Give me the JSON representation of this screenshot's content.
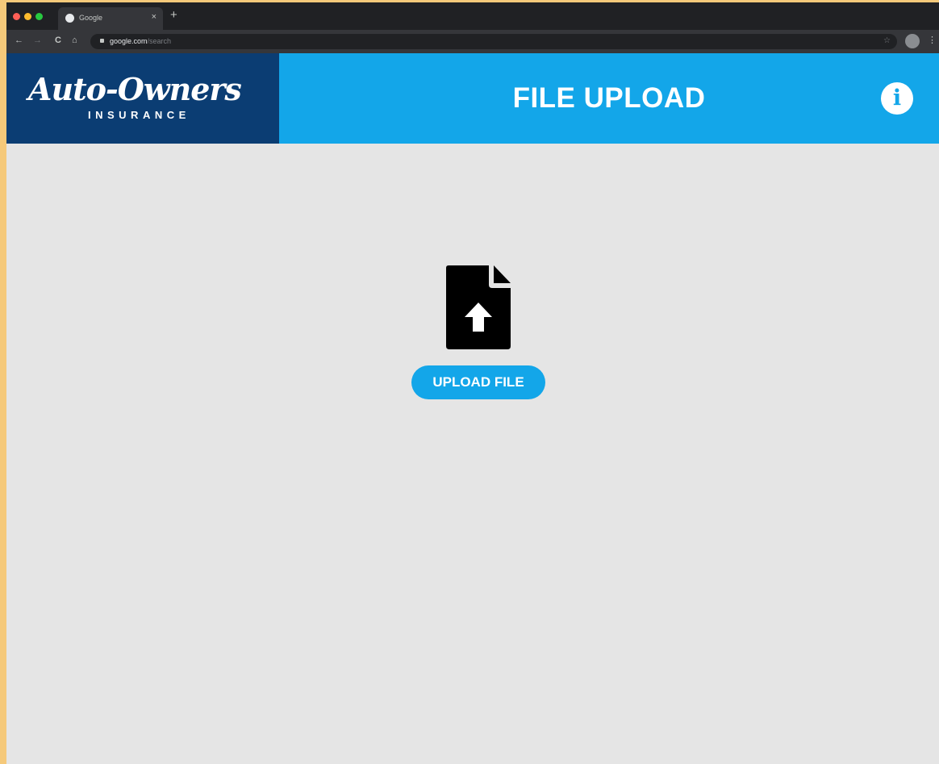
{
  "browser": {
    "tab_title": "Google",
    "tab_close": "×",
    "new_tab": "+",
    "url_host": "google.com",
    "url_path": "/search",
    "nav_back": "←",
    "nav_forward": "→",
    "nav_reload": "C",
    "nav_home": "⌂",
    "star": "☆",
    "menu": "⋮",
    "traffic_colors": [
      "#ff5f57",
      "#febc2e",
      "#28c840"
    ]
  },
  "header": {
    "logo_main": "Auto-Owners",
    "logo_sub": "INSURANCE",
    "title": "FILE UPLOAD",
    "info_icon": "info-icon",
    "info_glyph": "i",
    "logo_bg": "#0b3d73",
    "accent": "#13a6e9"
  },
  "main": {
    "icon": "file-upload-icon",
    "button_label": "UPLOAD FILE",
    "background": "#e5e5e5"
  }
}
